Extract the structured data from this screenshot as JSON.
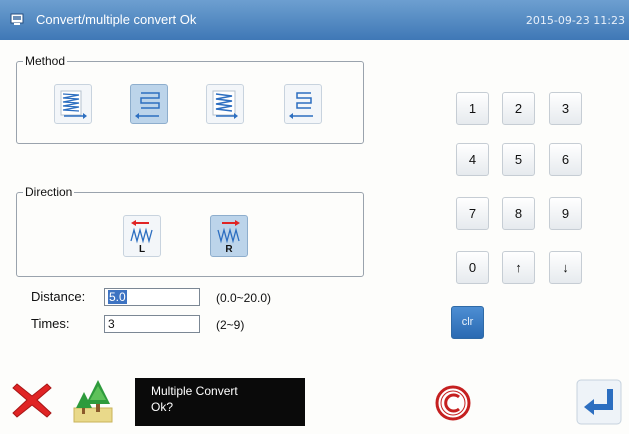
{
  "titlebar": {
    "title": "Convert/multiple convert  Ok",
    "datetime": "2015-09-23 11:23"
  },
  "method": {
    "label": "Method",
    "options": [
      "convert-up",
      "convert-left",
      "convert-up-alt",
      "convert-right"
    ],
    "selected_index": 1
  },
  "direction": {
    "label": "Direction",
    "options": [
      {
        "letter": "L"
      },
      {
        "letter": "R"
      }
    ],
    "selected": "R"
  },
  "distance": {
    "label": "Distance:",
    "value": "5.0",
    "range": "(0.0~20.0)"
  },
  "times": {
    "label": "Times:",
    "value": "3",
    "range": "(2~9)"
  },
  "keypad": {
    "keys": [
      "1",
      "2",
      "3",
      "4",
      "5",
      "6",
      "7",
      "8",
      "9",
      "0",
      "↑",
      "↓"
    ],
    "clear": "clr"
  },
  "message": {
    "line1": "Multiple Convert",
    "line2": "Ok?"
  },
  "colors": {
    "title_bar": "#3f78b6",
    "cancel_red": "#e02424",
    "enter_blue": "#2c6ec0"
  }
}
